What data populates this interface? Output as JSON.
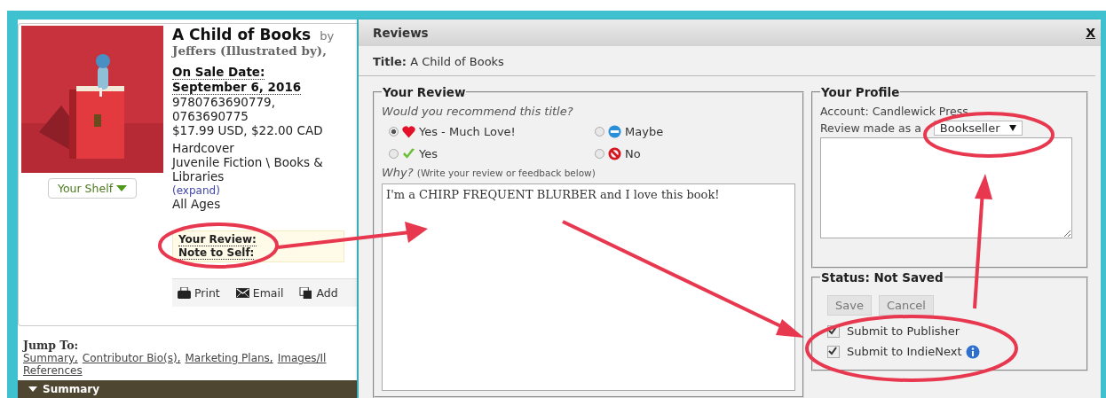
{
  "page": {
    "kind": "picture",
    "shelf_button": "Your Shelf",
    "title": "A Child of Books",
    "byline": "by",
    "contributors": "Jeffers (Illustrated by),",
    "on_sale_label": "On Sale Date:",
    "on_sale_date": "September 6, 2016",
    "isbns": [
      "9780763690779,",
      "0763690775"
    ],
    "price": "$17.99 USD, $22.00 CAD",
    "format": "Hardcover",
    "category": "Juvenile Fiction \\ Books & Libraries",
    "expand_link": "(expand)",
    "age": "All Ages",
    "review_labels": [
      "Your Review:",
      "Note to Self:"
    ],
    "actions": [
      {
        "label": "Print",
        "kind": "print"
      },
      {
        "label": "Email",
        "kind": "email"
      },
      {
        "label": "Add",
        "kind": "add"
      }
    ],
    "jump_label": "Jump To:",
    "jump_links": [
      "Summary,",
      "Contributor Bio(s),",
      "Marketing Plans,",
      "Images/Il",
      "References"
    ],
    "section": {
      "label": "Summary",
      "expanded": true
    }
  },
  "modal": {
    "title": "Reviews",
    "close": "X",
    "title_label": "Title:",
    "title_value": "A Child of Books",
    "review": {
      "legend": "Your Review",
      "question": "Would you recommend this title?",
      "options": [
        {
          "label": "Yes - Much Love!",
          "kind": "love",
          "selected": true
        },
        {
          "label": "Maybe",
          "kind": "maybe",
          "selected": false
        },
        {
          "label": "Yes",
          "kind": "yes",
          "selected": false
        },
        {
          "label": "No",
          "kind": "no",
          "selected": false
        }
      ],
      "why_label": "Why?",
      "why_hint": "(Write your review or feedback below)",
      "text": "I'm a CHIRP FREQUENT BLURBER and I love this book!"
    },
    "profile": {
      "legend": "Your Profile",
      "account": "Account: Candlewick Press",
      "role_label": "Review made as a",
      "role": "Bookseller"
    },
    "status": {
      "legend": "Status: Not Saved",
      "buttons": [
        "Save",
        "Cancel"
      ],
      "options": [
        {
          "label": "Submit to Publisher",
          "checked": true,
          "info": false
        },
        {
          "label": "Submit to IndieNext",
          "checked": true,
          "info": true
        }
      ]
    }
  }
}
